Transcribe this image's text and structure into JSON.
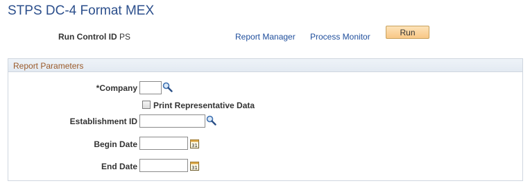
{
  "page": {
    "title": "STPS DC-4 Format MEX"
  },
  "run_control": {
    "label": "Run Control ID",
    "value": "PS",
    "report_manager_link": "Report Manager",
    "process_monitor_link": "Process Monitor",
    "run_button": "Run"
  },
  "report_parameters": {
    "title": "Report Parameters",
    "company": {
      "label": "*Company",
      "value": ""
    },
    "print_representative": {
      "label": "Print Representative Data",
      "checked": false
    },
    "establishment_id": {
      "label": "Establishment ID",
      "value": ""
    },
    "begin_date": {
      "label": "Begin Date",
      "value": ""
    },
    "end_date": {
      "label": "End Date",
      "value": ""
    }
  },
  "colors": {
    "title": "#2c4f8c",
    "link": "#1f4e9c",
    "run_button": "#f8c785",
    "group_title": "#9a5a2a",
    "group_border": "#cfd6df"
  },
  "icons": {
    "lookup": "magnifier-icon",
    "calendar": "calendar-icon"
  }
}
